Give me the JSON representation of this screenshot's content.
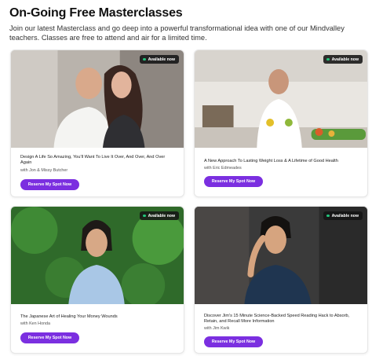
{
  "page": {
    "title": "On-Going Free Masterclasses",
    "intro": "Join our latest Masterclass and go deep into a powerful transformational idea with one of our Mindvalley teachers. Classes are free to attend and air for a limited time."
  },
  "colors": {
    "accent": "#7b2fe0",
    "badge_dot": "#22c27a",
    "badge_bg": "#141414"
  },
  "cards": [
    {
      "badge": "Available now",
      "title": "Design A Life So Amazing, You'll Want To Live It Over, And Over, And Over Again",
      "author": "with Jon & Missy Butcher",
      "button": "Reserve My Spot Now"
    },
    {
      "badge": "Available now",
      "title": "A New Approach To Lasting Weight Loss & A Lifetime of Good Health",
      "author": "with Eric Edmeades",
      "button": "Reserve My Spot Now"
    },
    {
      "badge": "Available now",
      "title": "The Japanese Art of Healing Your Money Wounds",
      "author": "with Ken Honda",
      "button": "Reserve My Spot Now"
    },
    {
      "badge": "Available now",
      "title": "Discover Jim's 15 Minute Science-Backed Speed Reading Hack to Absorb, Retain, and Recall More Information",
      "author": "with Jim Kwik",
      "button": "Reserve My Spot Now"
    }
  ]
}
